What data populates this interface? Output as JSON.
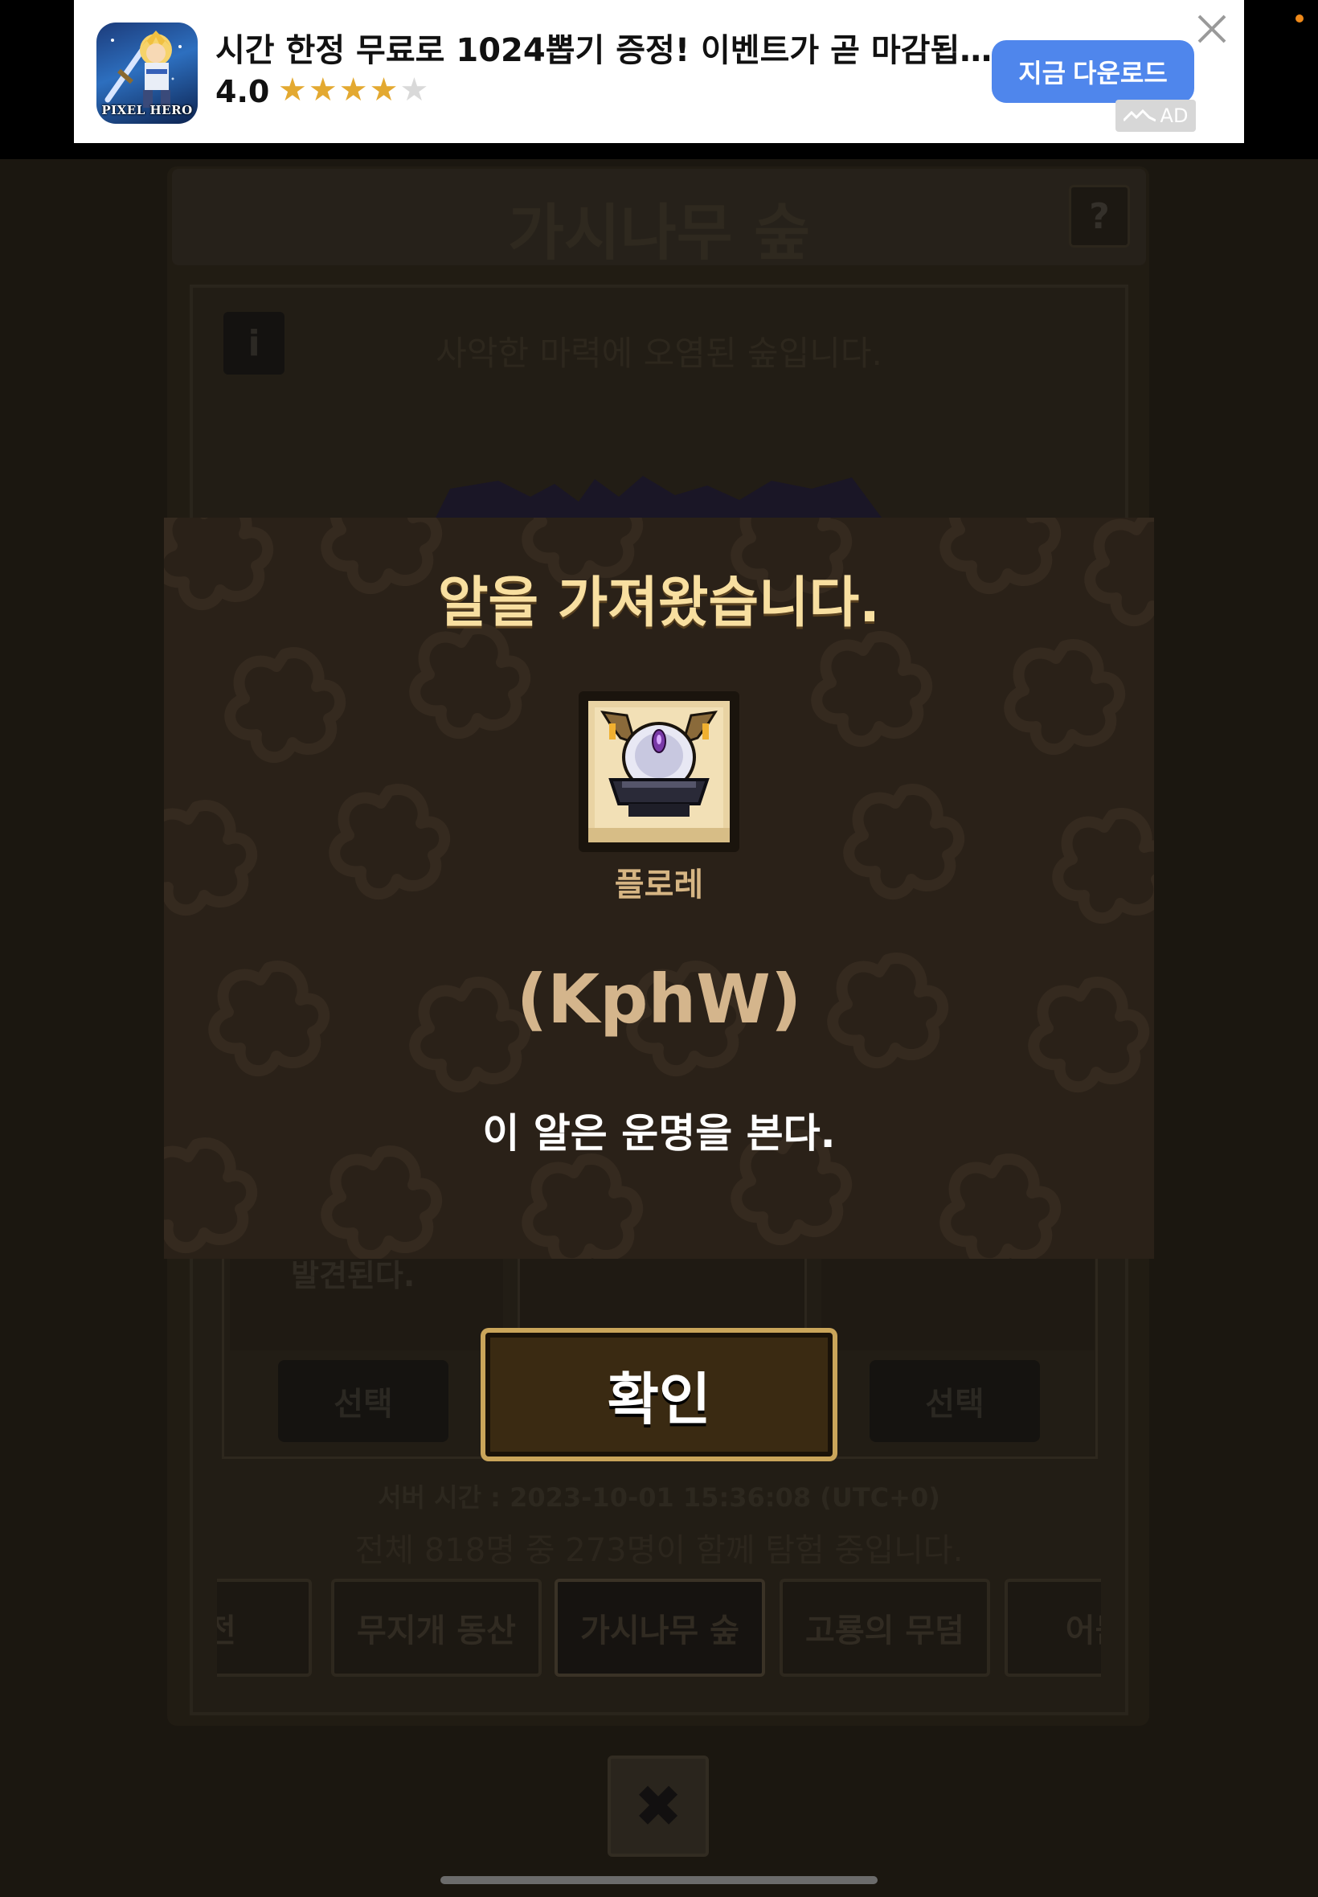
{
  "ad": {
    "title": "시간 한정 무료로 1024뽑기 증정! 이벤트가 곧 마감됩…",
    "rating": "4.0",
    "stars_filled": 4,
    "stars_total": 5,
    "cta_label": "지금 다운로드",
    "badge_label": "AD",
    "app_icon_label": "PIXEL HERO",
    "cta_color": "#4f86ec",
    "star_color": "#e3a931"
  },
  "game": {
    "area_title": "가시나무 숲",
    "help_label": "?",
    "info_label": "i",
    "area_description": "사악한 마력에 오염된 숲입니다.",
    "card_text": "발견된다.",
    "select_left_label": "선택",
    "select_right_label": "선택",
    "server_time": "서버 시간 : 2023-10-01 15:36:08 (UTC+0)",
    "explore_status": "전체 818명 중 273명이 함께 탐험 중입니다.",
    "area_tabs": [
      {
        "label": "신전",
        "active": false
      },
      {
        "label": "무지개 동산",
        "active": false
      },
      {
        "label": "가시나무 숲",
        "active": true
      },
      {
        "label": "고룡의 무덤",
        "active": false
      },
      {
        "label": "어둠의",
        "active": false
      }
    ],
    "close_label": "✖"
  },
  "modal": {
    "title": "알을 가져왔습니다.",
    "egg_name": "플로레",
    "egg_code": "(KphW)",
    "egg_description": "이 알은 운명을 본다.",
    "confirm_label": "확인",
    "title_color": "#f8dfa0"
  }
}
